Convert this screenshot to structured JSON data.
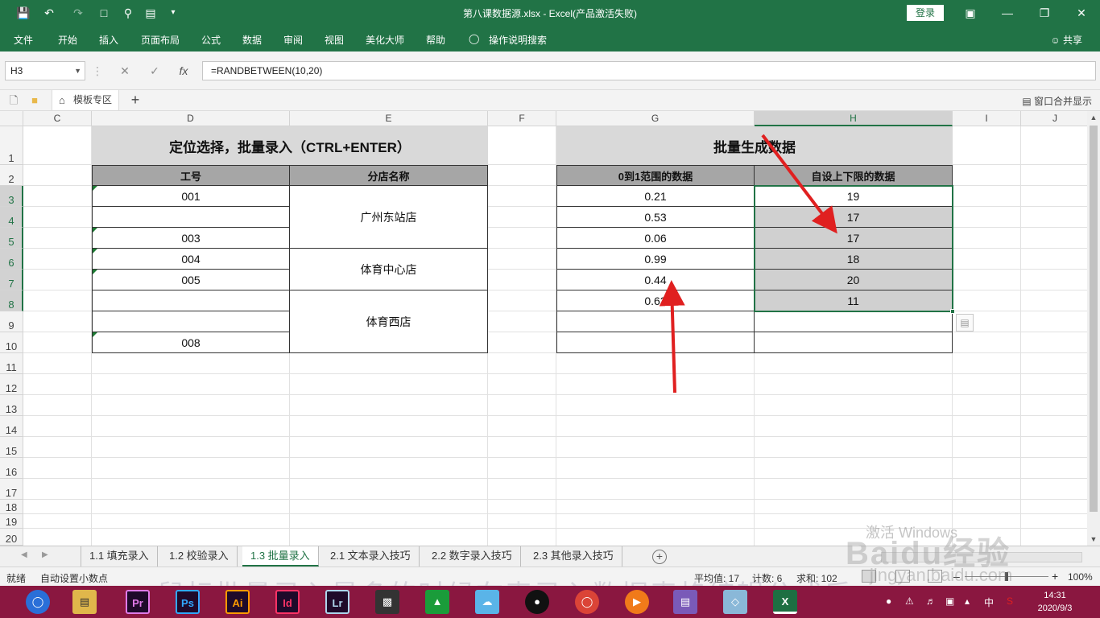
{
  "window": {
    "title": "第八课数据源.xlsx  -  Excel(产品激活失败)",
    "login_label": "登录"
  },
  "ribbon": {
    "tabs": [
      "文件",
      "开始",
      "插入",
      "页面布局",
      "公式",
      "数据",
      "审阅",
      "视图",
      "美化大师",
      "帮助",
      "操作说明搜索"
    ],
    "share_label": "共享"
  },
  "formula_bar": {
    "name_box": "H3",
    "formula": "=RANDBETWEEN(10,20)"
  },
  "tab_strip": {
    "template_tab": "模板专区",
    "merge_label": "窗口合并显示"
  },
  "grid": {
    "columns": [
      "C",
      "D",
      "E",
      "F",
      "G",
      "H",
      "I",
      "J"
    ],
    "selected_column": "H",
    "rows": [
      "1",
      "2",
      "3",
      "4",
      "5",
      "6",
      "7",
      "8",
      "9",
      "10",
      "11",
      "12",
      "13",
      "14",
      "15",
      "16",
      "17",
      "18",
      "19",
      "20"
    ]
  },
  "table_left": {
    "title": "定位选择，批量录入（CTRL+ENTER）",
    "headers": [
      "工号",
      "分店名称"
    ],
    "ids": [
      "001",
      "",
      "003",
      "004",
      "005",
      "",
      "",
      "008"
    ],
    "stores": [
      "广州东站店",
      "体育中心店",
      "体育西店"
    ]
  },
  "table_right": {
    "title": "批量生成数据",
    "headers": [
      "0到1范围的数据",
      "自设上下限的数据"
    ],
    "g_values": [
      "0.21",
      "0.53",
      "0.06",
      "0.99",
      "0.44",
      "0.63",
      "",
      ""
    ],
    "h_values": [
      "19",
      "17",
      "17",
      "18",
      "20",
      "11",
      "",
      ""
    ]
  },
  "sheets": {
    "tabs": [
      "1.1 填充录入",
      "1.2 校验录入",
      "1.3 批量录入",
      "2.1 文本录入技巧",
      "2.2 数字录入技巧",
      "2.3 其他录入技巧"
    ],
    "active": "1.3 批量录入"
  },
  "status": {
    "ready": "就绪",
    "auto_decimal": "自动设置小数点",
    "average": "平均值: 17",
    "count": "计数: 6",
    "sum": "求和: 102",
    "zoom": "100%"
  },
  "taskbar": {
    "apps": [
      "Pr",
      "Ps",
      "Ai",
      "Id",
      "Lr",
      "X"
    ],
    "time": "14:31",
    "date": "2020/9/3",
    "ime": "中"
  },
  "watermarks": {
    "activate": "激活 Windows",
    "baidu": "Baidu经验",
    "url": "jingyan.baidu.com",
    "caption": "鼠标批量录入最多的时候在表录入数据表格编辑公式后"
  },
  "colors": {
    "excel_green": "#217346",
    "arrow_red": "#e02020",
    "header_gray": "#a6a6a6",
    "title_gray": "#d9d9d9"
  }
}
